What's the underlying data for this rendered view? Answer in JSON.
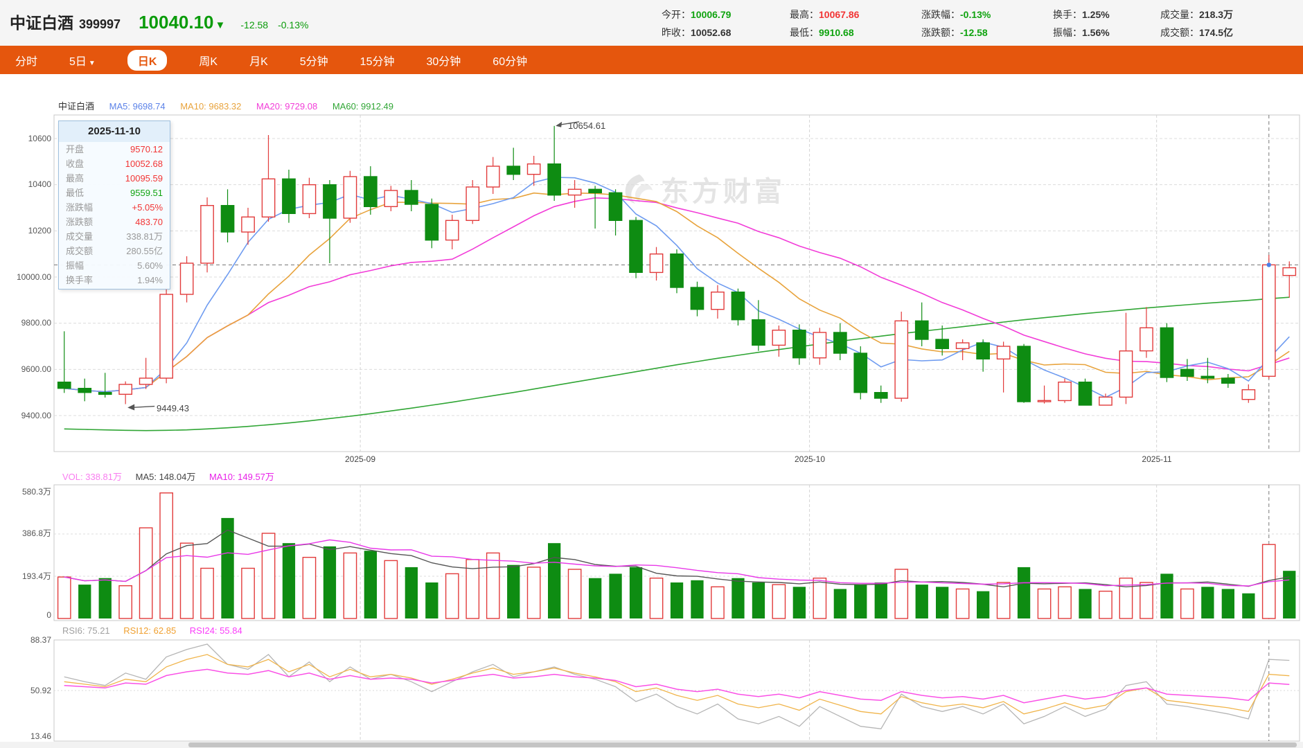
{
  "header": {
    "name": "中证白酒",
    "code": "399997",
    "price": "10040.10",
    "direction": "▼",
    "change": "-12.58",
    "change_pct": "-0.13%",
    "stats_rows": [
      [
        {
          "label": "今开：",
          "value": "10006.79"
        },
        {
          "label": "最高：",
          "value": "10067.86"
        },
        {
          "label": "涨跌幅：",
          "value": "-0.13%"
        },
        {
          "label": "换手：",
          "value": "1.25%"
        },
        {
          "label": "成交量：",
          "value": "218.3万"
        }
      ],
      [
        {
          "label": "昨收：",
          "value": "10052.68"
        },
        {
          "label": "最低：",
          "value": "9910.68"
        },
        {
          "label": "涨跌额：",
          "value": "-12.58"
        },
        {
          "label": "振幅：",
          "value": "1.56%"
        },
        {
          "label": "成交额：",
          "value": "174.5亿"
        }
      ]
    ]
  },
  "tabs": {
    "caret": "▼",
    "items": [
      {
        "label": "分时"
      },
      {
        "label": "5日"
      },
      {
        "label": "日K"
      },
      {
        "label": "周K"
      },
      {
        "label": "月K"
      },
      {
        "label": "5分钟"
      },
      {
        "label": "15分钟"
      },
      {
        "label": "30分钟"
      },
      {
        "label": "60分钟"
      }
    ]
  },
  "legend": {
    "title": "中证白酒",
    "ma5": "MA5: 9698.74",
    "ma10": "MA10: 9683.32",
    "ma20": "MA20: 9729.08",
    "ma60": "MA60: 9912.49"
  },
  "vol_legend": {
    "vol": "VOL: 338.81万",
    "ma5": "MA5: 148.04万",
    "ma10": "MA10: 149.57万"
  },
  "rsi_legend": {
    "rsi6": "RSI6: 75.21",
    "rsi12": "RSI12: 62.85",
    "rsi24": "RSI24: 55.84"
  },
  "tooltip": {
    "date": "2025-11-10",
    "rows": [
      {
        "label": "开盘",
        "value": "9570.12"
      },
      {
        "label": "收盘",
        "value": "10052.68"
      },
      {
        "label": "最高",
        "value": "10095.59"
      },
      {
        "label": "最低",
        "value": "9559.51"
      },
      {
        "label": "涨跌幅",
        "value": "+5.05%"
      },
      {
        "label": "涨跌额",
        "value": "483.70"
      },
      {
        "label": "成交量",
        "value": "338.81万"
      },
      {
        "label": "成交额",
        "value": "280.55亿"
      },
      {
        "label": "振幅",
        "value": "5.60%"
      },
      {
        "label": "换手率",
        "value": "1.94%"
      }
    ]
  },
  "watermark": "东方财富",
  "colors": {
    "up_red": "#e23b3b",
    "down_green": "#0e8c12",
    "ma5": "#6e9bf0",
    "ma10": "#e8a33c",
    "ma20": "#f23cd8",
    "ma60": "#2fa534",
    "vol_ma5": "#555555",
    "vol_ma10": "#e838e8",
    "rsi6": "#b5b5b5",
    "rsi12": "#f0b44a",
    "rsi24": "#fa50e6",
    "accent_orange": "#e5560d"
  },
  "chart_data": {
    "type": "candlestick",
    "title": "中证白酒 日K",
    "price_axis": {
      "labels": [
        "10600",
        "10400",
        "10200",
        "10000.00",
        "9800.00",
        "9600.00",
        "9400.00"
      ],
      "values": [
        10600,
        10400,
        10200,
        10000,
        9800,
        9600,
        9400
      ]
    },
    "volume_axis": {
      "labels": [
        "580.3万",
        "386.8万",
        "193.4万",
        "0"
      ],
      "values": [
        580.3,
        386.8,
        193.4,
        0
      ]
    },
    "rsi_axis": {
      "labels": [
        "88.37",
        "50.92",
        "13.46"
      ],
      "values": [
        88.37,
        50.92,
        13.46
      ]
    },
    "x_ticks": [
      {
        "label": "2025-09",
        "index": 15
      },
      {
        "label": "2025-10",
        "index": 37
      },
      {
        "label": "2025-11",
        "index": 54
      }
    ],
    "selected_index": 59,
    "selected_close": 10052.68,
    "annotations": [
      {
        "text": "10654.61",
        "index": 24,
        "price": 10654.61,
        "side": "high"
      },
      {
        "text": "9449.43",
        "index": 3,
        "price": 9449.43,
        "side": "low"
      }
    ],
    "candles": [
      [
        9545,
        9765,
        9498,
        9518
      ],
      [
        9518,
        9560,
        9462,
        9500
      ],
      [
        9500,
        9585,
        9478,
        9492
      ],
      [
        9492,
        9548,
        9449.43,
        9535
      ],
      [
        9535,
        9650,
        9515,
        9562
      ],
      [
        9562,
        9955,
        9540,
        9925
      ],
      [
        9925,
        10090,
        9890,
        10060
      ],
      [
        10060,
        10345,
        10020,
        10310
      ],
      [
        10310,
        10380,
        10150,
        10195
      ],
      [
        10195,
        10300,
        10140,
        10260
      ],
      [
        10260,
        10615,
        10240,
        10425
      ],
      [
        10425,
        10465,
        10235,
        10275
      ],
      [
        10275,
        10430,
        10255,
        10400
      ],
      [
        10400,
        10420,
        10060,
        10255
      ],
      [
        10255,
        10460,
        10235,
        10435
      ],
      [
        10435,
        10480,
        10270,
        10305
      ],
      [
        10305,
        10395,
        10285,
        10375
      ],
      [
        10375,
        10420,
        10285,
        10315
      ],
      [
        10315,
        10340,
        10125,
        10160
      ],
      [
        10160,
        10270,
        10120,
        10245
      ],
      [
        10245,
        10420,
        10230,
        10390
      ],
      [
        10390,
        10520,
        10360,
        10480
      ],
      [
        10480,
        10560,
        10420,
        10445
      ],
      [
        10445,
        10525,
        10395,
        10490
      ],
      [
        10490,
        10654.61,
        10330,
        10355
      ],
      [
        10355,
        10420,
        10300,
        10380
      ],
      [
        10380,
        10395,
        10210,
        10365
      ],
      [
        10365,
        10380,
        10180,
        10245
      ],
      [
        10245,
        10260,
        9995,
        10020
      ],
      [
        10020,
        10130,
        9985,
        10100
      ],
      [
        10100,
        10120,
        9930,
        9955
      ],
      [
        9955,
        9980,
        9830,
        9860
      ],
      [
        9860,
        9965,
        9820,
        9935
      ],
      [
        9935,
        9950,
        9790,
        9815
      ],
      [
        9815,
        9900,
        9680,
        9705
      ],
      [
        9705,
        9790,
        9655,
        9770
      ],
      [
        9770,
        9795,
        9620,
        9650
      ],
      [
        9650,
        9780,
        9620,
        9760
      ],
      [
        9760,
        9800,
        9640,
        9670
      ],
      [
        9670,
        9700,
        9470,
        9500
      ],
      [
        9500,
        9530,
        9455,
        9475
      ],
      [
        9475,
        9850,
        9460,
        9810
      ],
      [
        9810,
        9890,
        9700,
        9730
      ],
      [
        9730,
        9790,
        9660,
        9690
      ],
      [
        9690,
        9730,
        9640,
        9715
      ],
      [
        9715,
        9730,
        9590,
        9645
      ],
      [
        9645,
        9720,
        9500,
        9700
      ],
      [
        9700,
        9710,
        9455,
        9460
      ],
      [
        9460,
        9530,
        9452,
        9465
      ],
      [
        9465,
        9560,
        9455,
        9545
      ],
      [
        9545,
        9560,
        9455,
        9445
      ],
      [
        9445,
        9495,
        9452,
        9480
      ],
      [
        9480,
        9845,
        9450,
        9680
      ],
      [
        9680,
        9870,
        9650,
        9780
      ],
      [
        9780,
        9800,
        9545,
        9565
      ],
      [
        9600,
        9645,
        9550,
        9570
      ],
      [
        9570,
        9650,
        9540,
        9562
      ],
      [
        9562,
        9580,
        9520,
        9540
      ],
      [
        9470,
        9535,
        9455,
        9512
      ],
      [
        9570.12,
        10095.59,
        9559.51,
        10052.68
      ],
      [
        10006.79,
        10067.86,
        9910.68,
        10040.1
      ]
    ],
    "volumes": [
      190,
      155,
      185,
      150,
      415,
      575,
      345,
      230,
      460,
      230,
      390,
      345,
      280,
      330,
      300,
      310,
      265,
      235,
      165,
      205,
      270,
      300,
      245,
      235,
      345,
      225,
      185,
      205,
      235,
      185,
      165,
      175,
      145,
      185,
      165,
      155,
      145,
      185,
      135,
      155,
      165,
      225,
      155,
      145,
      135,
      125,
      165,
      235,
      135,
      145,
      135,
      125,
      185,
      165,
      205,
      135,
      145,
      135,
      115,
      338.81,
      218.3
    ],
    "ma60": [
      9342,
      9340,
      9338,
      9336,
      9335,
      9336,
      9338,
      9342,
      9347,
      9353,
      9360,
      9368,
      9377,
      9387,
      9397,
      9408,
      9420,
      9432,
      9445,
      9458,
      9472,
      9486,
      9500,
      9515,
      9530,
      9545,
      9560,
      9575,
      9590,
      9605,
      9620,
      9634,
      9648,
      9661,
      9674,
      9686,
      9698,
      9710,
      9722,
      9733,
      9744,
      9755,
      9765,
      9775,
      9785,
      9795,
      9805,
      9815,
      9824,
      9833,
      9842,
      9850,
      9858,
      9866,
      9873,
      9880,
      9887,
      9893,
      9899,
      9906,
      9912.49
    ],
    "rsi6": [
      62,
      58,
      55,
      65,
      60,
      78,
      84,
      88.37,
      72,
      68,
      80,
      62,
      74,
      58,
      70,
      60,
      64,
      58,
      50,
      58,
      66,
      72,
      62,
      66,
      70,
      64,
      60,
      54,
      42,
      48,
      38,
      32,
      40,
      28,
      24,
      30,
      22,
      38,
      30,
      22,
      20,
      48,
      38,
      34,
      38,
      32,
      40,
      24,
      30,
      38,
      30,
      36,
      55,
      58,
      40,
      38,
      35,
      32,
      28,
      76,
      75.21
    ],
    "rsi12": [
      58,
      56,
      54,
      60,
      58,
      70,
      76,
      80,
      72,
      70,
      76,
      66,
      72,
      62,
      68,
      62,
      64,
      61,
      56,
      60,
      65,
      69,
      64,
      66,
      69,
      65,
      62,
      58,
      50,
      53,
      47,
      43,
      47,
      40,
      37,
      40,
      35,
      44,
      39,
      34,
      32,
      46,
      41,
      38,
      40,
      37,
      42,
      32,
      36,
      41,
      36,
      39,
      50,
      53,
      43,
      41,
      39,
      37,
      34,
      64,
      62.85
    ],
    "rsi24": [
      55,
      54,
      53,
      57,
      56,
      63,
      66,
      68,
      65,
      64,
      67,
      62,
      65,
      60,
      63,
      60,
      61,
      60,
      57,
      59,
      62,
      64,
      61,
      62,
      64,
      62,
      61,
      59,
      54,
      56,
      52,
      50,
      52,
      48,
      46,
      48,
      45,
      50,
      47,
      44,
      43,
      50,
      47,
      45,
      46,
      44,
      47,
      41,
      44,
      47,
      44,
      46,
      51,
      53,
      48,
      47,
      46,
      45,
      43,
      57,
      55.84
    ]
  }
}
